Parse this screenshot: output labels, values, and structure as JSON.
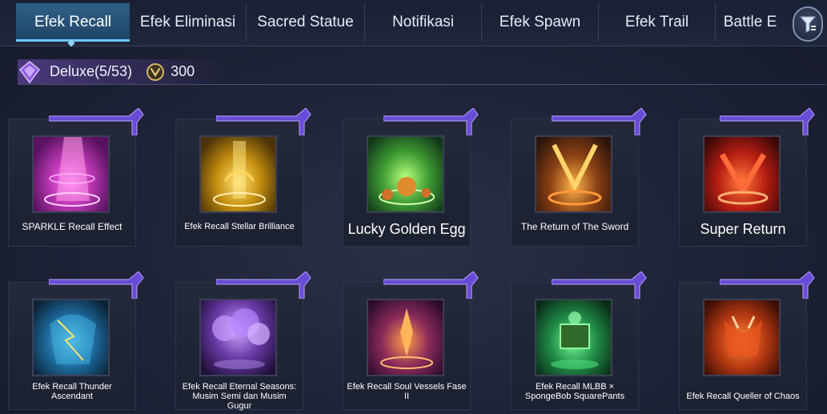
{
  "tabs": [
    {
      "label": "Efek Recall",
      "active": true
    },
    {
      "label": "Efek Eliminasi",
      "active": false
    },
    {
      "label": "Sacred Statue",
      "active": false
    },
    {
      "label": "Notifikasi",
      "active": false
    },
    {
      "label": "Efek Spawn",
      "active": false
    },
    {
      "label": "Efek Trail",
      "active": false
    },
    {
      "label": "Battle E",
      "active": false
    }
  ],
  "filter": {
    "icon": "filter-icon"
  },
  "deluxe": {
    "label": "Deluxe(5/53)",
    "coin_value": "300",
    "gem_icon": "deluxe-gem-icon",
    "coin_icon": "coin-icon"
  },
  "cards": [
    {
      "name": "SPARKLE Recall Effect",
      "thumb_color": "#d43fc0"
    },
    {
      "name": "Efek Recall Stellar Brilliance",
      "thumb_color": "#d6a423"
    },
    {
      "name": "Lucky Golden Egg",
      "thumb_color": "#4aa34a"
    },
    {
      "name": "The Return of The Sword",
      "thumb_color": "#b3702a"
    },
    {
      "name": "Super Return",
      "thumb_color": "#d8381e"
    },
    {
      "name": "Efek Recall Thunder Ascendant",
      "thumb_color": "#2a7fae"
    },
    {
      "name": "Efek Recall Eternal Seasons: Musim Semi dan Musim Gugur",
      "thumb_color": "#8a5cc4"
    },
    {
      "name": "Efek Recall Soul Vessels Fase II",
      "thumb_color": "#c8501e"
    },
    {
      "name": "Efek Recall MLBB × SpongeBob SquarePants",
      "thumb_color": "#2e9e4a"
    },
    {
      "name": "Efek Recall Queller of Chaos",
      "thumb_color": "#d55a1a"
    }
  ],
  "colors": {
    "accent_tab": "#2f5f86",
    "deluxe_purple": "#7a50be",
    "ribbon_purple": "#6a4bd6"
  }
}
